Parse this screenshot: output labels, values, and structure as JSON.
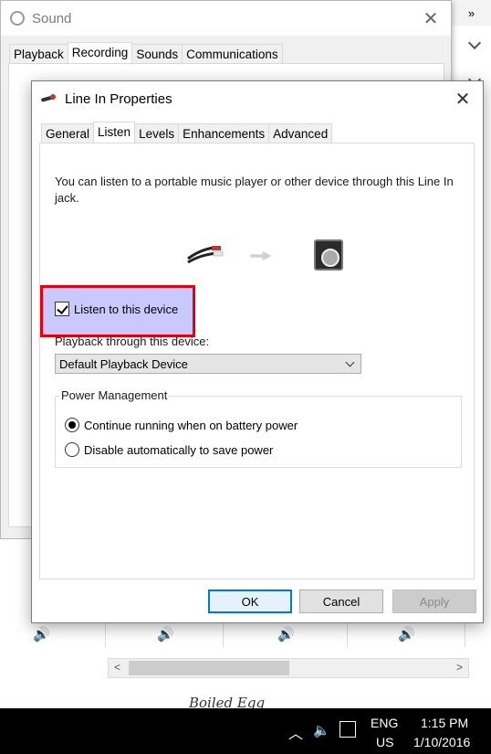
{
  "sound_window": {
    "title": "Sound",
    "tabs": [
      "Playback",
      "Recording",
      "Sounds",
      "Communications"
    ],
    "active_tab": "Recording"
  },
  "dialog": {
    "title": "Line In Properties",
    "tabs": [
      "General",
      "Listen",
      "Levels",
      "Enhancements",
      "Advanced"
    ],
    "active_tab": "Listen",
    "description": "You can listen to a portable music player or other device through this Line In jack.",
    "listen_checkbox": {
      "label": "Listen to this device",
      "checked": true
    },
    "playback_label": "Playback through this device:",
    "playback_select": {
      "value": "Default Playback Device"
    },
    "power_group": {
      "title": "Power Management",
      "options": [
        {
          "label": "Continue running when on battery power",
          "selected": true
        },
        {
          "label": "Disable automatically to save power",
          "selected": false
        }
      ]
    },
    "buttons": {
      "ok": "OK",
      "cancel": "Cancel",
      "apply": "Apply"
    }
  },
  "background": {
    "caption": "Boiled Egg"
  },
  "taskbar": {
    "language_top": "ENG",
    "language_bottom": "US",
    "time": "1:15 PM",
    "date": "1/10/2016"
  },
  "colors": {
    "highlight_fill": "#c9c9ff",
    "highlight_border": "#e4000f",
    "accent": "#0078d7"
  },
  "icons": [
    "sound-icon",
    "line-in-icon",
    "jack-icon",
    "arrow-icon",
    "speaker-icon",
    "volume-icon",
    "notification-icon"
  ]
}
